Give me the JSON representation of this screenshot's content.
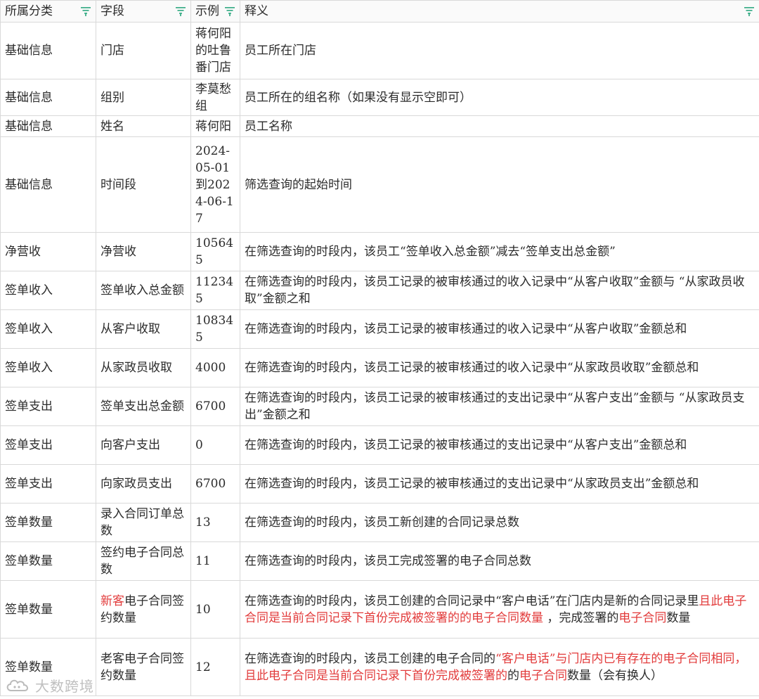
{
  "columns": [
    {
      "label": "所属分类",
      "filter_icon": "filter-icon"
    },
    {
      "label": "字段",
      "filter_icon": "filter-icon"
    },
    {
      "label": "示例",
      "filter_icon": "filter-icon"
    },
    {
      "label": "释义",
      "filter_icon": "filter-icon"
    }
  ],
  "rows": [
    {
      "category": "基础信息",
      "field": "门店",
      "example": "蒋何阳的吐鲁番门店",
      "desc": [
        {
          "t": "员工所在门店"
        }
      ]
    },
    {
      "category": "基础信息",
      "field": "组别",
      "example": "李莫愁组",
      "desc": [
        {
          "t": "员工所在的组名称（如果没有显示空即可）"
        }
      ]
    },
    {
      "category": "基础信息",
      "field": "姓名",
      "example": "蒋何阳",
      "desc": [
        {
          "t": "员工名称"
        }
      ]
    },
    {
      "category": "基础信息",
      "field": "时间段",
      "example": "2024-05-01到2024-06-17",
      "desc": [
        {
          "t": "筛选查询的起始时间"
        }
      ]
    },
    {
      "category": "净营收",
      "field": "净营收",
      "example": "105645",
      "desc": [
        {
          "t": "在筛选查询的时段内，该员工“签单收入总金额”减去“签单支出总金额”"
        }
      ]
    },
    {
      "category": "签单收入",
      "field": "签单收入总金额",
      "example": "112345",
      "desc": [
        {
          "t": "在筛选查询的时段内，该员工记录的被审核通过的收入记录中“从客户收取”金额与 “从家政员收取”金额之和"
        }
      ]
    },
    {
      "category": "签单收入",
      "field": "从客户收取",
      "example": "108345",
      "desc": [
        {
          "t": "在筛选查询的时段内，该员工记录的被审核通过的收入记录中“从客户收取”金额总和"
        }
      ]
    },
    {
      "category": "签单收入",
      "field": "从家政员收取",
      "example": "4000",
      "desc": [
        {
          "t": "在筛选查询的时段内，该员工记录的被审核通过的收入记录中“从家政员收取”金额总和"
        }
      ]
    },
    {
      "category": "签单支出",
      "field": "签单支出总金额",
      "example": "6700",
      "desc": [
        {
          "t": "在筛选查询的时段内，该员工记录的被审核通过的支出记录中“从客户支出”金额与 “从家政员支出”金额之和"
        }
      ]
    },
    {
      "category": "签单支出",
      "field": "向客户支出",
      "example": "0",
      "desc": [
        {
          "t": "在筛选查询的时段内，该员工记录的被审核通过的支出记录中“从客户支出”金额总和"
        }
      ]
    },
    {
      "category": "签单支出",
      "field": "向家政员支出",
      "example": "6700",
      "desc": [
        {
          "t": "在筛选查询的时段内，该员工记录的被审核通过的支出记录中“从家政员支出”金额总和"
        }
      ]
    },
    {
      "category": "签单数量",
      "field": "录入合同订单总数",
      "example": "13",
      "desc": [
        {
          "t": "在筛选查询的时段内，该员工新创建的合同记录总数"
        }
      ]
    },
    {
      "category": "签单数量",
      "field": "签约电子合同总数",
      "example": "11",
      "desc": [
        {
          "t": "在筛选查询的时段内，该员工完成签署的电子合同总数"
        }
      ]
    },
    {
      "category": "签单数量",
      "field_parts": [
        {
          "t": "新客",
          "red": true
        },
        {
          "t": "电子合同签约数量"
        }
      ],
      "example": "10",
      "desc": [
        {
          "t": "在筛选查询的时段内，该员工创建的合同记录中“客户电话”在门店内是新的合同记录里"
        },
        {
          "t": "且此电子合同是当前合同记录下首份完成被签署的的电子合同数量",
          "red": true
        },
        {
          "t": " ，完成签署的"
        },
        {
          "t": "电子合同",
          "red": true
        },
        {
          "t": "数量"
        }
      ]
    },
    {
      "category": "签单数量",
      "field": "老客电子合同签约数量",
      "example": "12",
      "desc": [
        {
          "t": "在筛选查询的时段内，该员工创建的电子合同的"
        },
        {
          "t": "“客户电话”与门店内已有存在的电子合同相同，且此电子合同是当前合同记录下首份完成被签署的",
          "red": true
        },
        {
          "t": "的"
        },
        {
          "t": "电子合同",
          "red": true
        },
        {
          "t": "数量（会有换人）"
        }
      ]
    }
  ],
  "watermark": {
    "text": "大数跨境",
    "icon": "cloud-logo-icon"
  },
  "colors": {
    "filter": "#3fae8a",
    "highlight": "#e23b3b",
    "border": "#d9d9d9"
  }
}
